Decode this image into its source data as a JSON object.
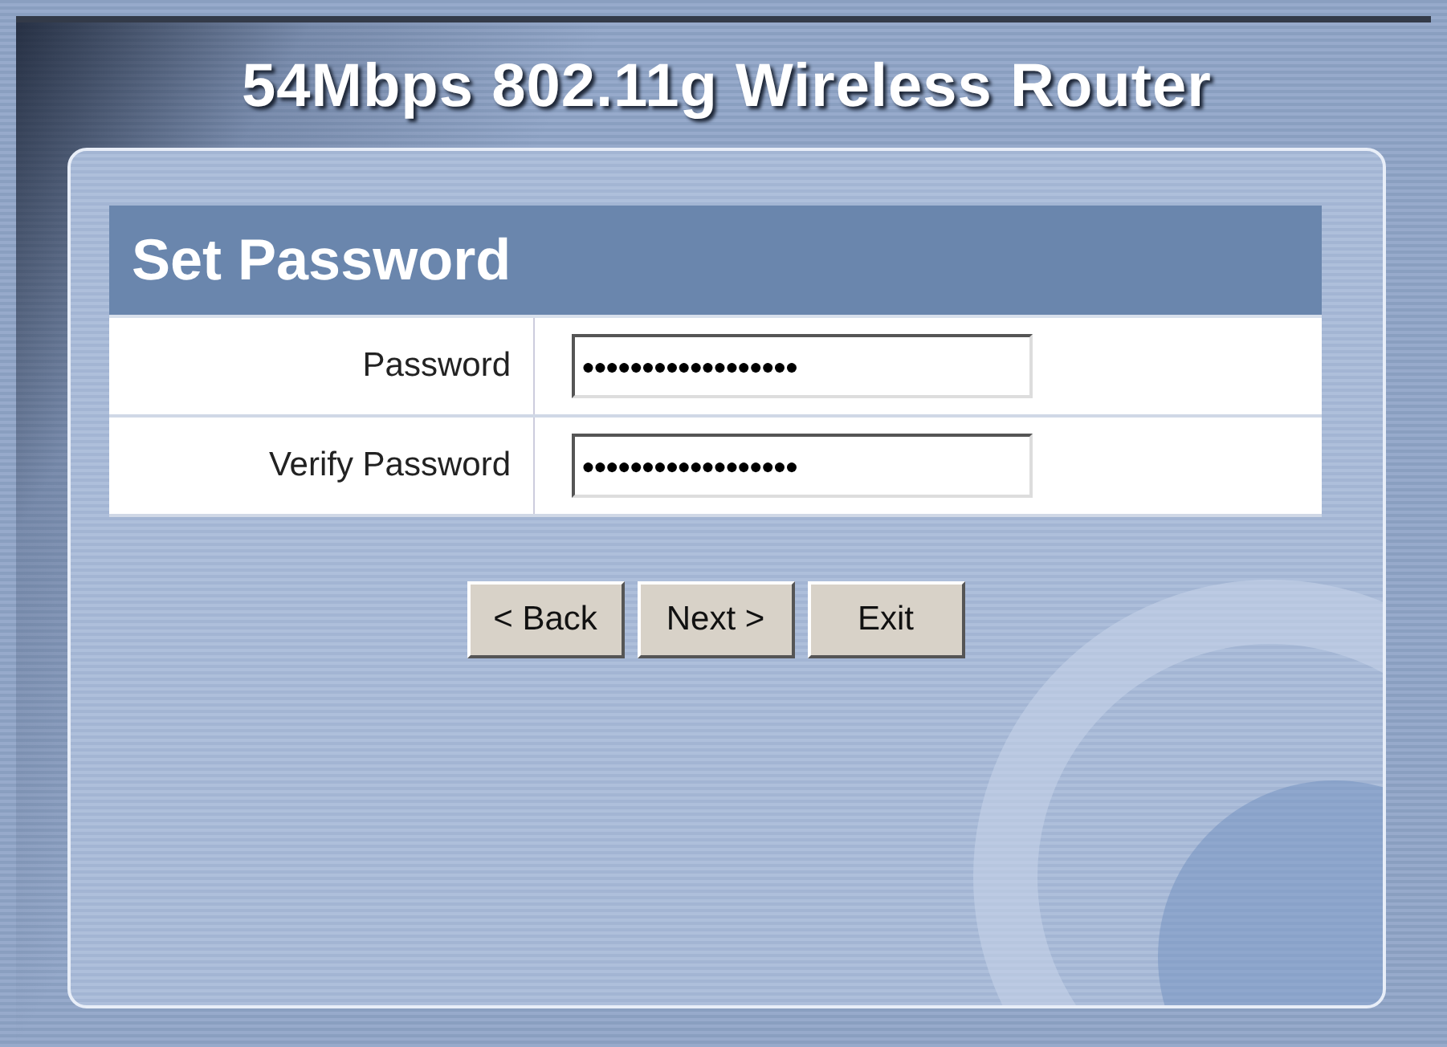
{
  "window": {
    "title": "54Mbps 802.11g Wireless Router"
  },
  "form": {
    "heading": "Set Password",
    "fields": [
      {
        "label": "Password",
        "value": "●●●●●●●●●●●●●●●●●●"
      },
      {
        "label": "Verify Password",
        "value": "●●●●●●●●●●●●●●●●●●"
      }
    ]
  },
  "buttons": [
    "< Back",
    "Next >",
    "Exit"
  ]
}
